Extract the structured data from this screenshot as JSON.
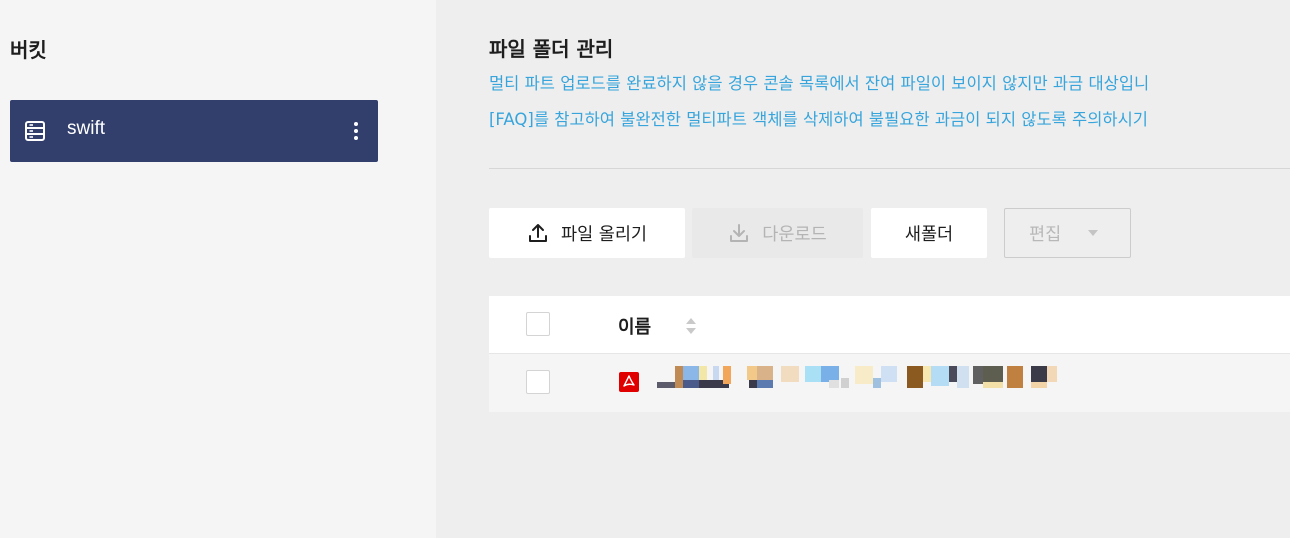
{
  "sidebar": {
    "title": "버킷",
    "bucket": {
      "name": "swift",
      "icon": "server-icon",
      "more_icon": "more-vertical-icon",
      "color": "#323f6c"
    }
  },
  "main": {
    "title": "파일 폴더 관리",
    "notice_line1": "멀티 파트 업로드를 완료하지 않을 경우 콘솔 목록에서 잔여 파일이 보이지 않지만 과금 대상입니",
    "notice_line2": "[FAQ]를 참고하여 불완전한 멀티파트 객체를 삭제하여 불필요한 과금이 되지 않도록 주의하시기",
    "notice_color": "#37a5dc"
  },
  "toolbar": {
    "upload_label": "파일 올리기",
    "upload_icon": "upload-icon",
    "download_label": "다운로드",
    "download_icon": "download-icon",
    "download_disabled": true,
    "newfolder_label": "새폴더",
    "edit_label": "편집",
    "edit_icon": "caret-down-icon",
    "edit_disabled": true
  },
  "table": {
    "columns": [
      {
        "label": "이름",
        "sortable": true,
        "sort_icon": "sort-icon"
      }
    ],
    "rows": [
      {
        "type_icon": "pdf-icon",
        "name_redacted": true
      }
    ]
  }
}
